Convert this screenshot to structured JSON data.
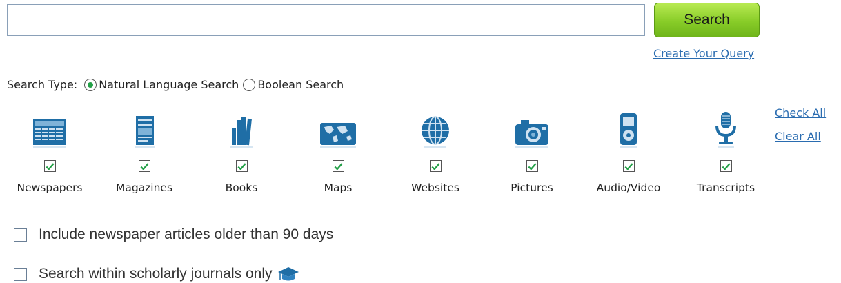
{
  "search": {
    "placeholder": "",
    "value": "",
    "button_label": "Search",
    "create_query_label": "Create Your Query"
  },
  "search_type": {
    "label": "Search Type:",
    "options": [
      {
        "label": "Natural Language Search",
        "selected": true
      },
      {
        "label": "Boolean Search",
        "selected": false
      }
    ]
  },
  "categories": [
    {
      "label": "Newspapers",
      "checked": true,
      "icon": "newspaper-icon"
    },
    {
      "label": "Magazines",
      "checked": true,
      "icon": "magazine-icon"
    },
    {
      "label": "Books",
      "checked": true,
      "icon": "books-icon"
    },
    {
      "label": "Maps",
      "checked": true,
      "icon": "map-icon"
    },
    {
      "label": "Websites",
      "checked": true,
      "icon": "globe-icon"
    },
    {
      "label": "Pictures",
      "checked": true,
      "icon": "camera-icon"
    },
    {
      "label": "Audio/Video",
      "checked": true,
      "icon": "media-player-icon"
    },
    {
      "label": "Transcripts",
      "checked": true,
      "icon": "microphone-icon"
    }
  ],
  "actions": {
    "check_all": "Check All",
    "clear_all": "Clear All"
  },
  "options": [
    {
      "label": "Include newspaper articles older than 90 days",
      "checked": false
    },
    {
      "label": "Search within scholarly journals only",
      "checked": false,
      "icon": "graduation-cap-icon"
    }
  ],
  "colors": {
    "accent": "#2a6cb0",
    "button": "#88cc28",
    "icon_blue": "#1f6ea6",
    "check_green": "#23a047"
  }
}
